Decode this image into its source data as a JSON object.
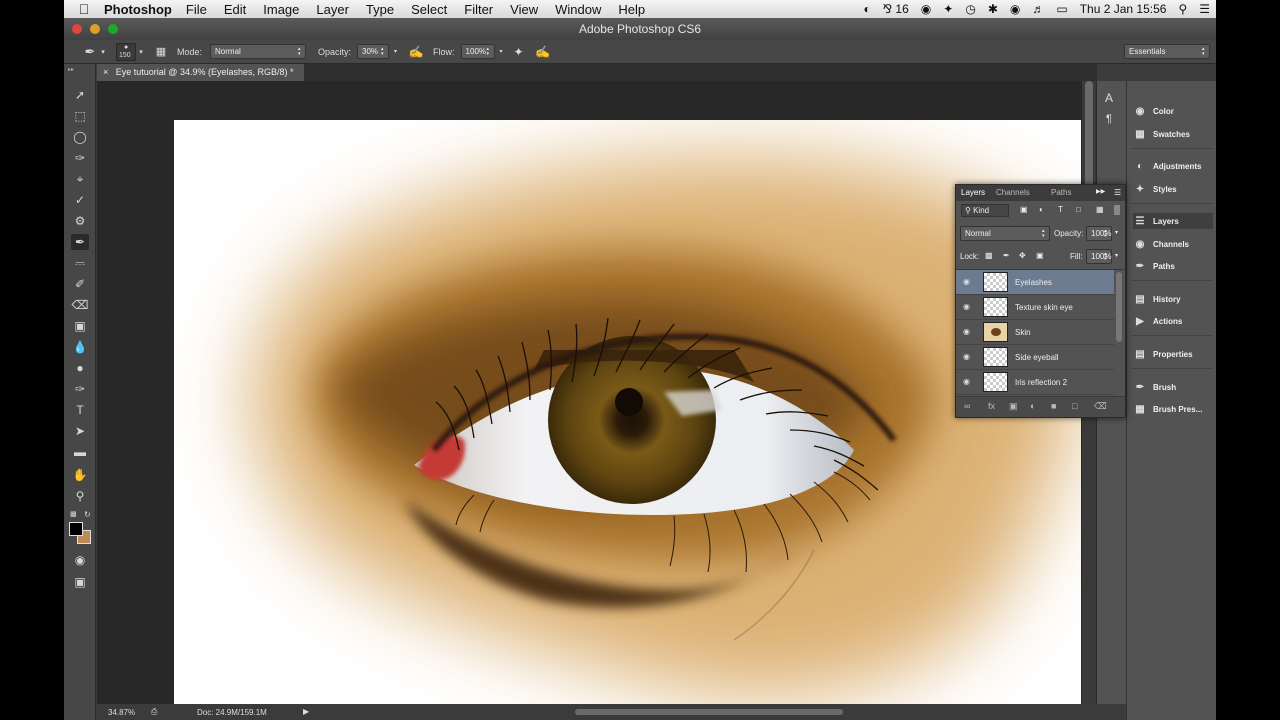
{
  "menubar": {
    "app_name": "Photoshop",
    "menus": [
      "File",
      "Edit",
      "Image",
      "Layer",
      "Type",
      "Select",
      "Filter",
      "View",
      "Window",
      "Help"
    ],
    "status": {
      "adobe_count": "16",
      "date_time": "Thu 2 Jan  15:56"
    }
  },
  "window": {
    "title": "Adobe Photoshop CS6"
  },
  "options": {
    "brush_size": "150",
    "mode_label": "Mode:",
    "mode_value": "Normal",
    "opacity_label": "Opacity:",
    "opacity_value": "30%",
    "flow_label": "Flow:",
    "flow_value": "100%",
    "workspace": "Essentials"
  },
  "document": {
    "tab_title": "Eye tutuorial @ 34.9% (Eyelashes, RGB/8) *",
    "zoom": "34.87%",
    "doc_size": "Doc: 24.9M/159.1M"
  },
  "dock": {
    "items": [
      "Color",
      "Swatches",
      "Adjustments",
      "Styles",
      "Layers",
      "Channels",
      "Paths",
      "History",
      "Actions",
      "Properties",
      "Brush",
      "Brush Pres..."
    ]
  },
  "layers_panel": {
    "tabs": [
      "Layers",
      "Channels",
      "Paths"
    ],
    "filter_label": "Kind",
    "blend_mode": "Normal",
    "opacity_label": "Opacity:",
    "opacity_value": "100%",
    "lock_label": "Lock:",
    "fill_label": "Fill:",
    "fill_value": "100%",
    "layers": [
      "Eyelashes",
      "Texture skin eye",
      "Skin",
      "Side eyeball",
      "Iris reflection 2"
    ]
  }
}
